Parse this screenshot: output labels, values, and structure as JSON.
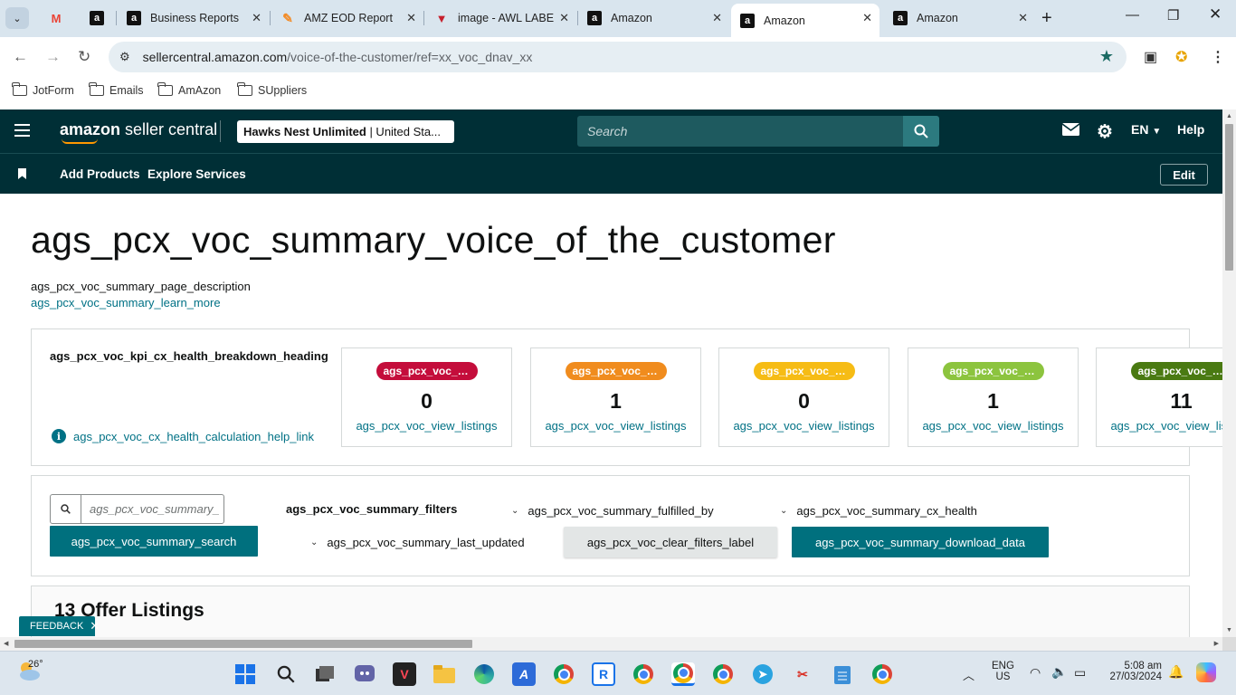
{
  "browser": {
    "tabs": [
      {
        "label": "",
        "icon": "gmail-icon"
      },
      {
        "label": "",
        "icon": "amazon-icon"
      },
      {
        "label": "Business Reports",
        "icon": "amazon-icon"
      },
      {
        "label": "AMZ EOD Report",
        "icon": "jotform-icon"
      },
      {
        "label": "image - AWL LABE",
        "icon": "jotform-icon"
      },
      {
        "label": "Amazon",
        "icon": "amazon-icon"
      },
      {
        "label": "Amazon",
        "icon": "amazon-icon",
        "active": true
      },
      {
        "label": "Amazon",
        "icon": "amazon-icon"
      }
    ],
    "url_host": "sellercentral.amazon.com",
    "url_path": "/voice-of-the-customer/ref=xx_voc_dnav_xx",
    "bookmarks": [
      "JotForm",
      "Emails",
      "AmAzon",
      "SUppliers"
    ]
  },
  "header": {
    "logo_bold": "amazon",
    "logo_rest": " seller central",
    "account_name": "Hawks Nest Unlimited",
    "account_region": " | United Sta...",
    "search_placeholder": "Search",
    "language": "EN",
    "help": "Help"
  },
  "subnav": {
    "links": [
      "Add Products",
      "Explore Services"
    ],
    "edit": "Edit"
  },
  "page": {
    "title": "ags_pcx_voc_summary_voice_of_the_customer",
    "description": "ags_pcx_voc_summary_page_description",
    "learn_more": "ags_pcx_voc_summary_learn_more",
    "kpi_heading": "ags_pcx_voc_kpi_cx_health_breakdown_heading",
    "help_link": "ags_pcx_voc_cx_health_calculation_help_link",
    "kpi_cards": [
      {
        "badge": "ags_pcx_voc_s...",
        "count": "0",
        "link": "ags_pcx_voc_view_listings",
        "color": "#c40d3b"
      },
      {
        "badge": "ags_pcx_voc_s...",
        "count": "1",
        "link": "ags_pcx_voc_view_listings",
        "color": "#f08c1e"
      },
      {
        "badge": "ags_pcx_voc_s...",
        "count": "0",
        "link": "ags_pcx_voc_view_listings",
        "color": "#f6bc15"
      },
      {
        "badge": "ags_pcx_voc_s...",
        "count": "1",
        "link": "ags_pcx_voc_view_listings",
        "color": "#8cc43e"
      },
      {
        "badge": "ags_pcx_voc_s...",
        "count": "11",
        "link": "ags_pcx_voc_view_listings",
        "color": "#4a7a12"
      }
    ],
    "search_placeholder": "ags_pcx_voc_summary_",
    "search_button": "ags_pcx_voc_summary_search",
    "filters_label": "ags_pcx_voc_summary_filters",
    "filter_fulfilled_by": "ags_pcx_voc_summary_fulfilled_by",
    "filter_cx_health": "ags_pcx_voc_summary_cx_health",
    "filter_last_updated": "ags_pcx_voc_summary_last_updated",
    "clear_filters": "ags_pcx_voc_clear_filters_label",
    "download": "ags_pcx_voc_summary_download_data",
    "offer_listings": "13 Offer Listings",
    "feedback": "FEEDBACK"
  },
  "taskbar": {
    "temperature": "26°",
    "lang_line1": "ENG",
    "lang_line2": "US",
    "time": "5:08 am",
    "date": "27/03/2024"
  }
}
